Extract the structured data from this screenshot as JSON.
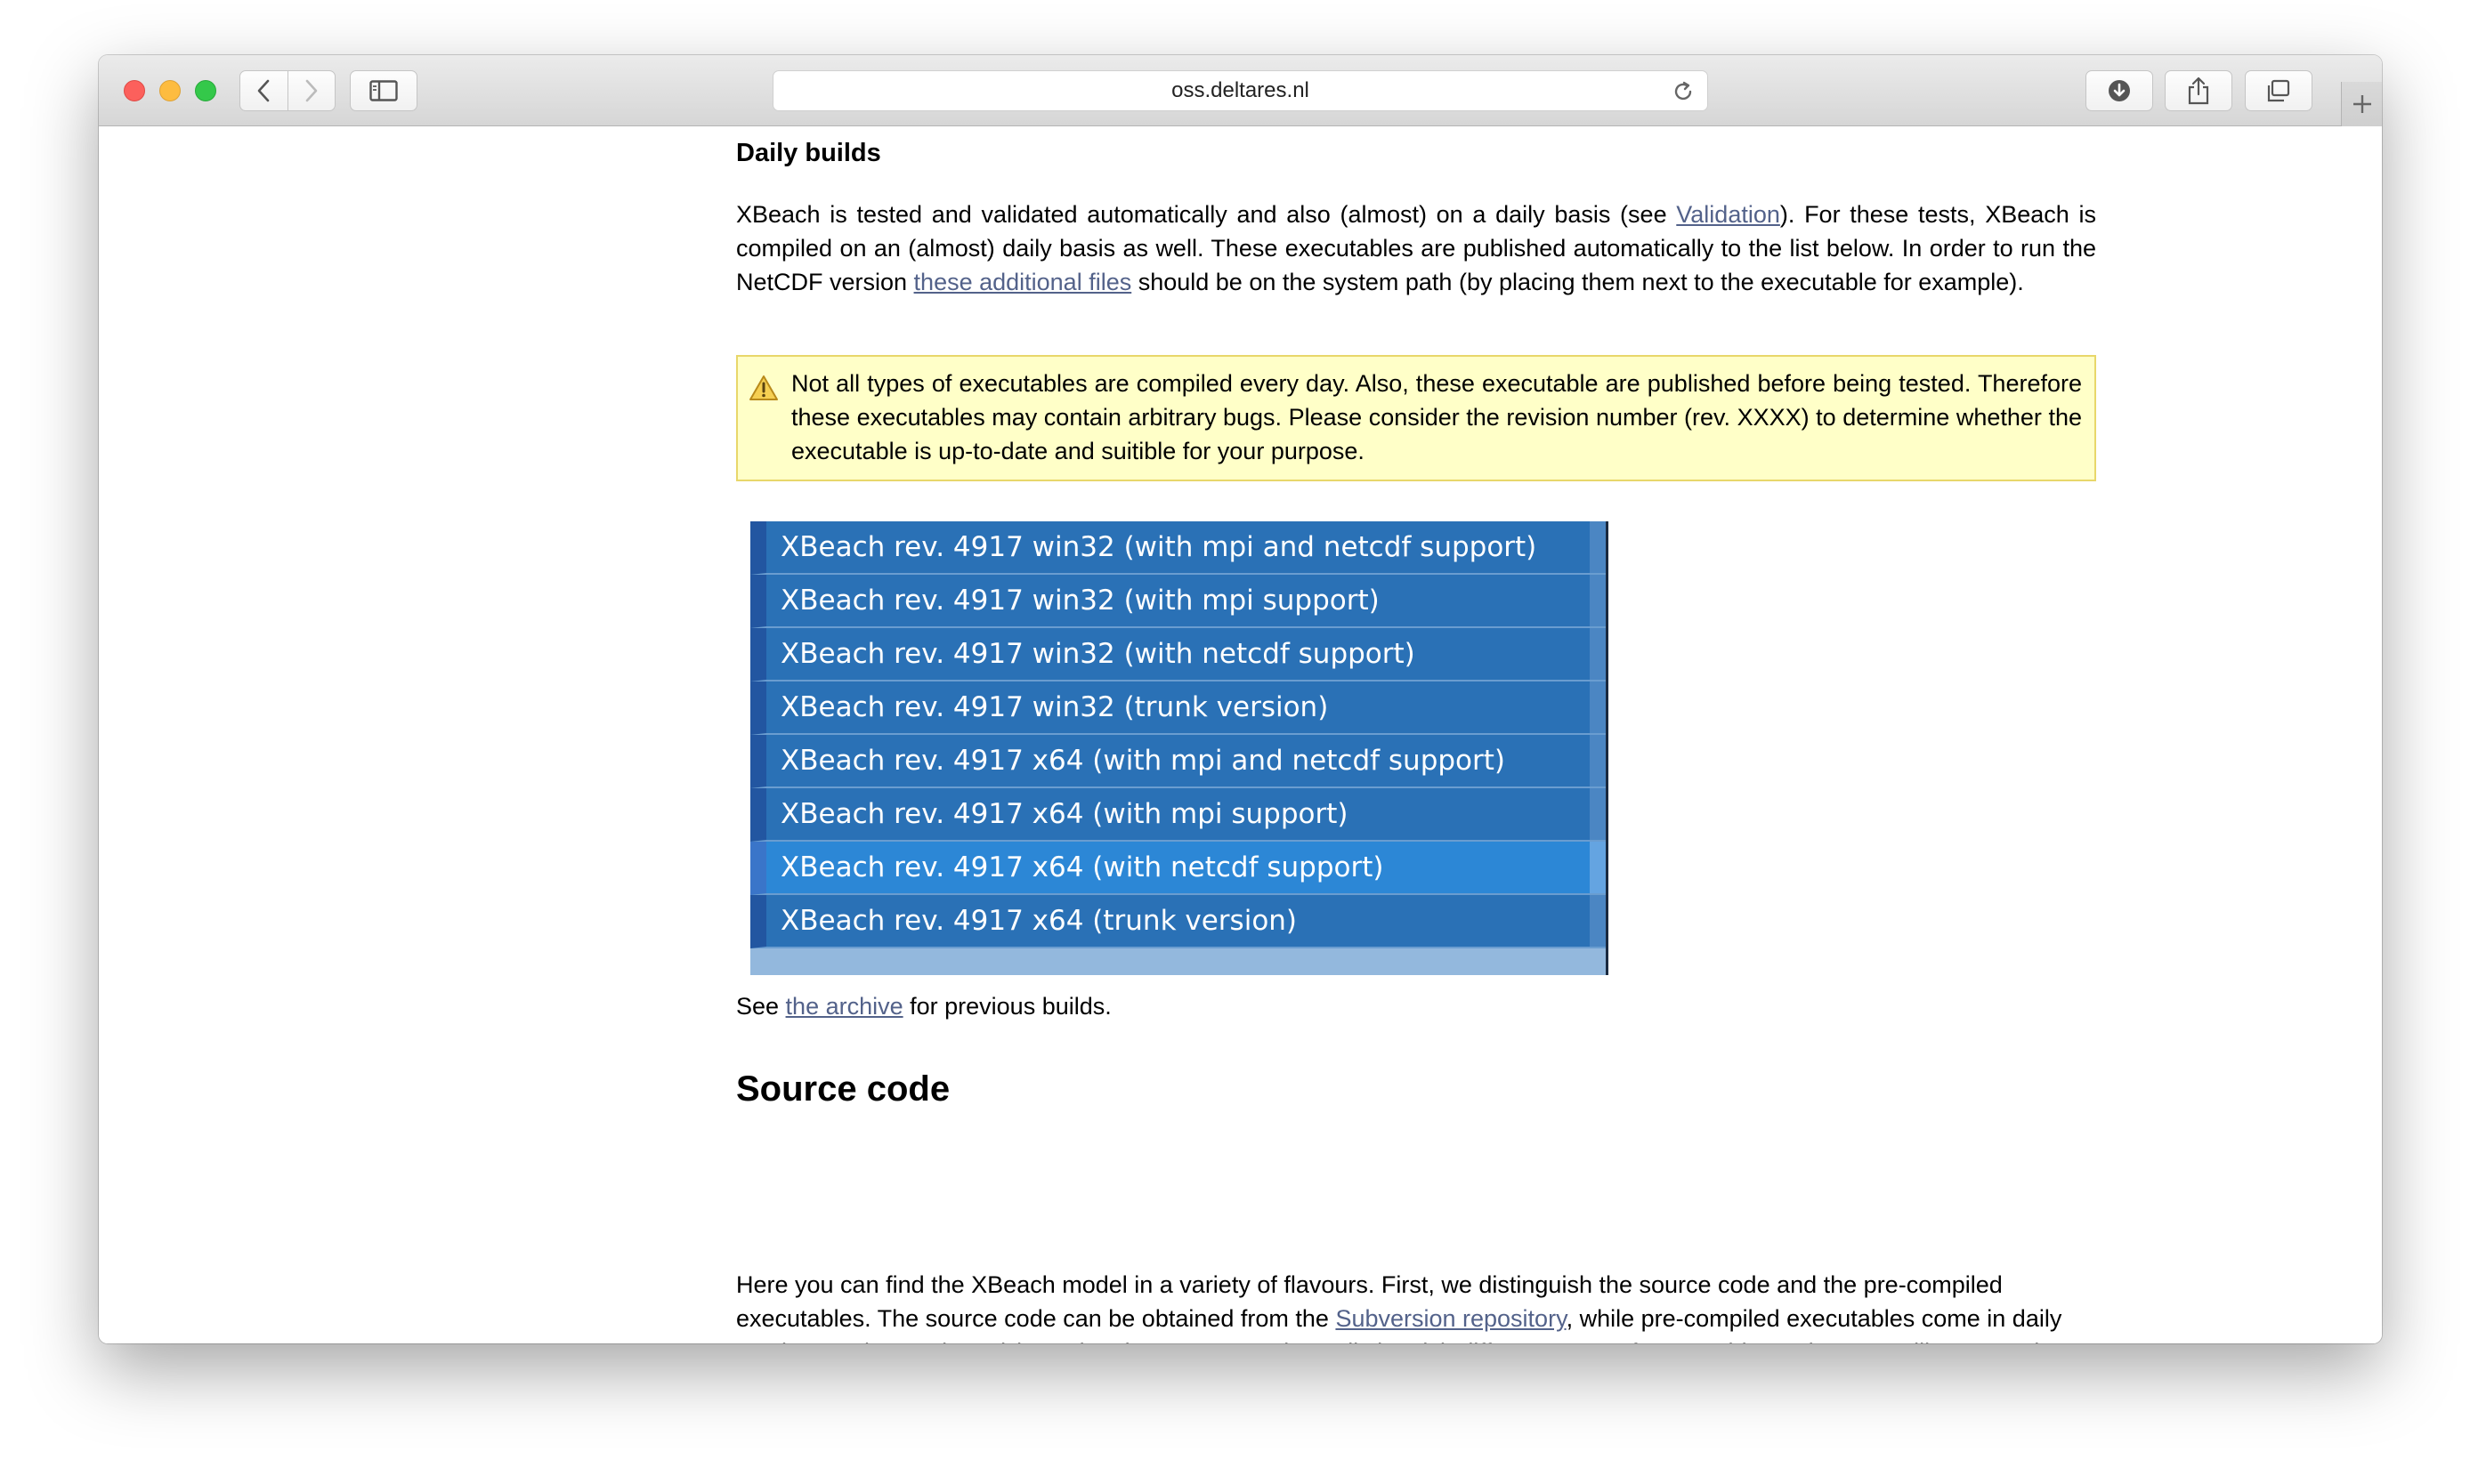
{
  "browser": {
    "url": "oss.deltares.nl"
  },
  "page": {
    "daily_builds_heading": "Daily builds",
    "intro": {
      "t1": "XBeach is tested and validated automatically and also (almost) on a daily basis (see ",
      "validation_link": "Validation",
      "t2": "). For these tests, XBeach is compiled on an (almost) daily basis as well. These executables are published automatically to the list below. In order to run the NetCDF version ",
      "files_link": "these additional files",
      "t3": " should be on the system path (by placing them next to the executable for example)."
    },
    "warning_text": "Not all types of executables are compiled every day. Also, these executable are published before being tested. Therefore these executables may contain arbitrary bugs. Please consider the revision number (rev. XXXX) to determine whether the executable is up-to-date and suitible for your purpose.",
    "downloads": [
      "XBeach rev. 4917 win32 (with mpi and netcdf support)",
      "XBeach rev. 4917 win32 (with mpi support)",
      "XBeach rev. 4917 win32 (with netcdf support)",
      "XBeach rev. 4917 win32 (trunk version)",
      "XBeach rev. 4917 x64 (with mpi and netcdf support)",
      "XBeach rev. 4917 x64 (with mpi support)",
      "XBeach rev. 4917 x64 (with netcdf support)",
      "XBeach rev. 4917 x64 (trunk version)"
    ],
    "archive": {
      "t1": "See ",
      "link": "the archive",
      "t2": " for previous builds."
    },
    "source_code_heading": "Source code",
    "source_para": {
      "t1": "Here you can find the XBeach model in a variety of flavours. First, we distinguish the source code and the pre-compiled executables. The source code can be obtained from the ",
      "link": "Subversion repository",
      "t2": ", while pre-compiled executables come in daily versions or (approximately) yearly releases. Second, we distinguish different types of executables. When compiling XBeach yourself, you can choose whatever type you like, but the pre-compiled executables come in four variations:"
    }
  },
  "colors": {
    "warning_bg": "#ffffc8",
    "download_bg": "#2a71b6",
    "download_hover": "#2c87d6",
    "link": "#53628a"
  }
}
